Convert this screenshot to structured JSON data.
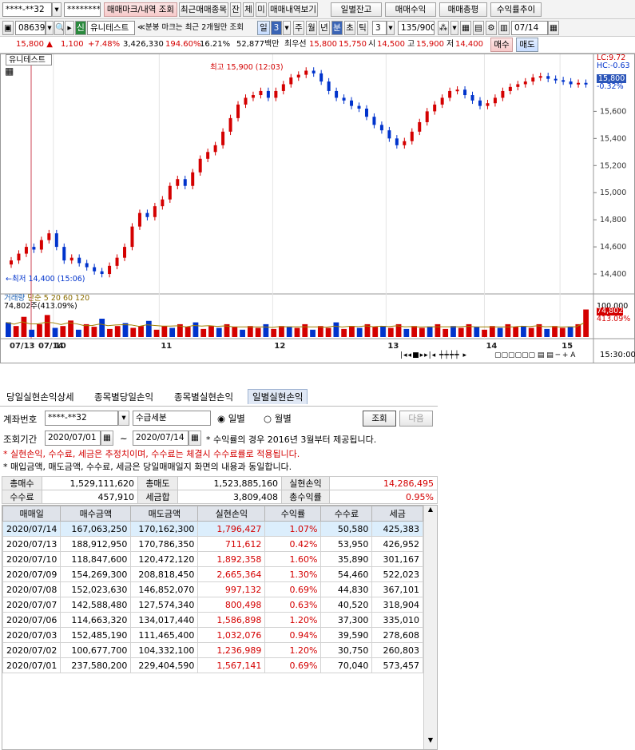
{
  "toolbar": {
    "account": "****-**32",
    "password": "********",
    "btn_markers": "매매마크/내역 조회",
    "btn_recent": "최근매매종목",
    "btn_jan": "잔",
    "btn_che": "체",
    "btn_mi": "미",
    "btn_history": "매매내역보기",
    "btn_daily_balance": "일별잔고",
    "btn_profit": "매매수익",
    "btn_review": "매매총평",
    "btn_trend": "수익률추이"
  },
  "controls": {
    "code": "086390",
    "new_badge": "신",
    "stock_name": "유니테스트",
    "notice": "분봉 마크는 최근 2개월만 조회",
    "period_day": "일",
    "period_num": "3",
    "period_week": "주",
    "period_month": "월",
    "period_year": "년",
    "period_minute": "분",
    "period_tick": "초",
    "period_t": "틱",
    "interval": "3",
    "count": "135/900",
    "date": "07/14"
  },
  "quote": {
    "price": "15,800",
    "change": "1,100",
    "change_pct": "+7.48%",
    "volume": "3,426,330",
    "vol_ratio": "194.60%",
    "turnover": "16.21%",
    "amount": "52,877백만",
    "label_best": "최우선",
    "ask": "15,800",
    "bid": "15,750",
    "label_open": "시",
    "open": "14,500",
    "label_high": "고",
    "high": "15,900",
    "label_low": "저",
    "low": "14,400",
    "buy": "매수",
    "sell": "매도"
  },
  "chart_data": {
    "type": "candlestick",
    "title": "유니테스트",
    "high_label": "최고 15,900 (12:03)",
    "low_label": "←최저 14,400 (15:06)",
    "lc": "LC:9.72",
    "hc": "HC:-0.63",
    "current_price": "15,800",
    "current_pct": "-0.32%",
    "y_ticks": [
      "15,600",
      "15,400",
      "15,200",
      "15,000",
      "14,800",
      "14,600",
      "14,400"
    ],
    "ylim": [
      14300,
      15950
    ],
    "x_ticks": [
      "07/13",
      "07/14",
      "10",
      "11",
      "12",
      "13",
      "14",
      "15"
    ],
    "price_path": [
      14500,
      14550,
      14600,
      14580,
      14650,
      14700,
      14600,
      14500,
      14520,
      14480,
      14450,
      14420,
      14400,
      14460,
      14520,
      14600,
      14750,
      14850,
      14820,
      14900,
      14950,
      15050,
      15100,
      15050,
      15150,
      15250,
      15300,
      15350,
      15450,
      15550,
      15650,
      15700,
      15720,
      15750,
      15700,
      15750,
      15800,
      15850,
      15870,
      15900,
      15880,
      15820,
      15750,
      15700,
      15680,
      15640,
      15620,
      15560,
      15500,
      15460,
      15400,
      15350,
      15380,
      15450,
      15520,
      15600,
      15650,
      15700,
      15750,
      15760,
      15720,
      15680,
      15640,
      15660,
      15700,
      15750,
      15780,
      15800,
      15820,
      15850,
      15860,
      15840,
      15830,
      15820,
      15800,
      15810,
      15800
    ],
    "volume_label": "거래량",
    "volume_ma_label": "단순 5 20 60 120",
    "volume_value": "74,802주(413.09%)",
    "vol_axis_top": "100,000",
    "vol_axis_value": "74,802",
    "vol_axis_pct": "413.09%",
    "vol_series": [
      40,
      30,
      55,
      20,
      35,
      60,
      25,
      30,
      45,
      20,
      35,
      28,
      50,
      22,
      30,
      38,
      25,
      30,
      44,
      20,
      30,
      25,
      35,
      28,
      40,
      22,
      30,
      25,
      35,
      28,
      20,
      30,
      25,
      35,
      22,
      30,
      28,
      25,
      35,
      20,
      30,
      25,
      40,
      22,
      30,
      25,
      35,
      28,
      30,
      25,
      35,
      22,
      30,
      25,
      28,
      35,
      22,
      30,
      25,
      35,
      28,
      20,
      30,
      25,
      35,
      28,
      30,
      25,
      35,
      22,
      30,
      25,
      28,
      35,
      75
    ],
    "time_label": "15:30:00"
  },
  "panel": {
    "tabs": [
      "당일실현손익상세",
      "종목별당일손익",
      "종목별실현손익",
      "일별실현손익"
    ],
    "label_account": "계좌번호",
    "account": "****-**32",
    "fee_option": "수급세분",
    "radio_daily": "일별",
    "radio_monthly": "월별",
    "btn_query": "조회",
    "btn_next": "다음",
    "label_period": "조회기간",
    "date_from": "2020/07/01",
    "date_to": "2020/07/14",
    "tilde": "~",
    "note1": "* 수익률의 경우 2016년 3월부터 제공됩니다.",
    "note2": "* 실현손익, 수수료, 세금은 추정치이며, 수수료는 체결시 수수료률로 적용됩니다.",
    "note3": "* 매입금액, 매도금액, 수수료, 세금은 당일매매일지 화면의 내용과 동일합니다."
  },
  "summary": {
    "total_buy_label": "총매수",
    "total_buy": "1,529,111,620",
    "total_sell_label": "총매도",
    "total_sell": "1,523,885,160",
    "realized_label": "실현손익",
    "realized": "14,286,495",
    "fee_label": "수수료",
    "fee": "457,910",
    "tax_label": "세금합",
    "tax": "3,809,408",
    "yield_label": "총수익률",
    "yield": "0.95%"
  },
  "table": {
    "headers": [
      "매매일",
      "매수금액",
      "매도금액",
      "실현손익",
      "수익률",
      "수수료",
      "세금"
    ],
    "rows": [
      [
        "2020/07/14",
        "167,063,250",
        "170,162,300",
        "1,796,427",
        "1.07%",
        "50,580",
        "425,383"
      ],
      [
        "2020/07/13",
        "188,912,950",
        "170,786,350",
        "711,612",
        "0.42%",
        "53,950",
        "426,952"
      ],
      [
        "2020/07/10",
        "118,847,600",
        "120,472,120",
        "1,892,358",
        "1.60%",
        "35,890",
        "301,167"
      ],
      [
        "2020/07/09",
        "154,269,300",
        "208,818,450",
        "2,665,364",
        "1.30%",
        "54,460",
        "522,023"
      ],
      [
        "2020/07/08",
        "152,023,630",
        "146,852,070",
        "997,132",
        "0.69%",
        "44,830",
        "367,101"
      ],
      [
        "2020/07/07",
        "142,588,480",
        "127,574,340",
        "800,498",
        "0.63%",
        "40,520",
        "318,904"
      ],
      [
        "2020/07/06",
        "114,663,320",
        "134,017,440",
        "1,586,898",
        "1.20%",
        "37,300",
        "335,010"
      ],
      [
        "2020/07/03",
        "152,485,190",
        "111,465,400",
        "1,032,076",
        "0.94%",
        "39,590",
        "278,608"
      ],
      [
        "2020/07/02",
        "100,677,700",
        "104,332,100",
        "1,236,989",
        "1.20%",
        "30,750",
        "260,803"
      ],
      [
        "2020/07/01",
        "237,580,200",
        "229,404,590",
        "1,567,141",
        "0.69%",
        "70,040",
        "573,457"
      ]
    ]
  },
  "colors": {
    "up": "#d40000",
    "down": "#0033cc",
    "accent": "#c9d9f0"
  }
}
